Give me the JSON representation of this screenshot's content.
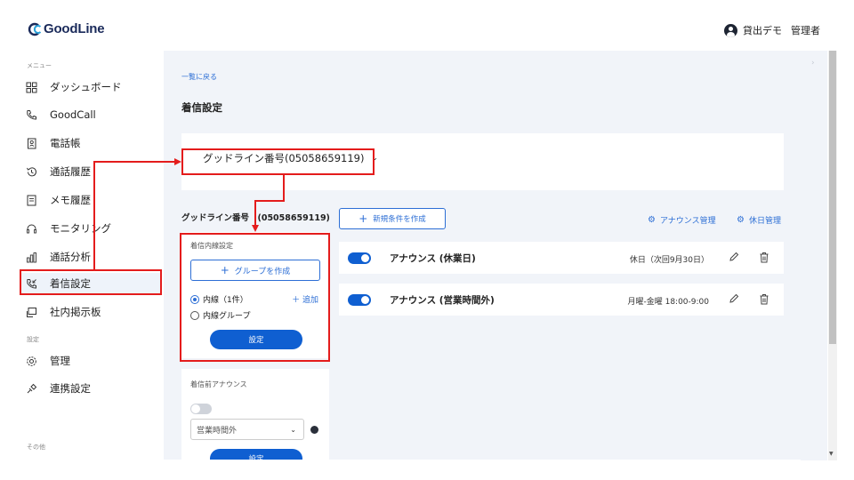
{
  "header": {
    "logo_text": "GoodLine",
    "user_name": "貸出デモ",
    "user_role": "管理者"
  },
  "sidebar": {
    "menu_label": "メニュー",
    "settings_label": "設定",
    "other_label": "その他",
    "items": [
      {
        "label": "ダッシュボード",
        "icon": "dashboard-icon"
      },
      {
        "label": "GoodCall",
        "icon": "phone-icon"
      },
      {
        "label": "電話帳",
        "icon": "phonebook-icon"
      },
      {
        "label": "通話履歴",
        "icon": "history-icon"
      },
      {
        "label": "メモ履歴",
        "icon": "memo-icon"
      },
      {
        "label": "モニタリング",
        "icon": "headset-icon"
      },
      {
        "label": "通話分析",
        "icon": "analytics-icon"
      },
      {
        "label": "着信設定",
        "icon": "incoming-call-icon"
      },
      {
        "label": "社内掲示板",
        "icon": "board-icon"
      }
    ],
    "settings_items": [
      {
        "label": "管理",
        "icon": "gear-icon"
      },
      {
        "label": "連携設定",
        "icon": "link-icon"
      }
    ]
  },
  "main": {
    "back_link": "一覧に戻る",
    "title": "着信設定",
    "line_select_value": "グッドライン番号(05058659119)",
    "line_label": "グッドライン番号　(05058659119)",
    "new_condition_button": "新規条件を作成",
    "announce_manage_link": "アナウンス管理",
    "holiday_manage_link": "休日管理",
    "extension_panel": {
      "title": "着信内線設定",
      "group_button": "グループを作成",
      "radio_extension": "内線（1件）",
      "add_link": "＋ 追加",
      "radio_group": "内線グループ",
      "set_button": "設定"
    },
    "pre_announce_panel": {
      "title": "着信前アナウンス",
      "select_value": "営業時間外",
      "set_button": "設定"
    },
    "announcements": [
      {
        "name": "アナウンス (休業日)",
        "schedule": "休日（次回9月30日）",
        "enabled": true
      },
      {
        "name": "アナウンス (営業時間外)",
        "schedule": "月曜-金曜 18:00-9:00",
        "enabled": true
      }
    ]
  },
  "colors": {
    "accent": "#2c6ed5",
    "primary_button": "#0f5fd1",
    "annotation_red": "#e41c1c",
    "content_bg": "#f1f4f9"
  }
}
